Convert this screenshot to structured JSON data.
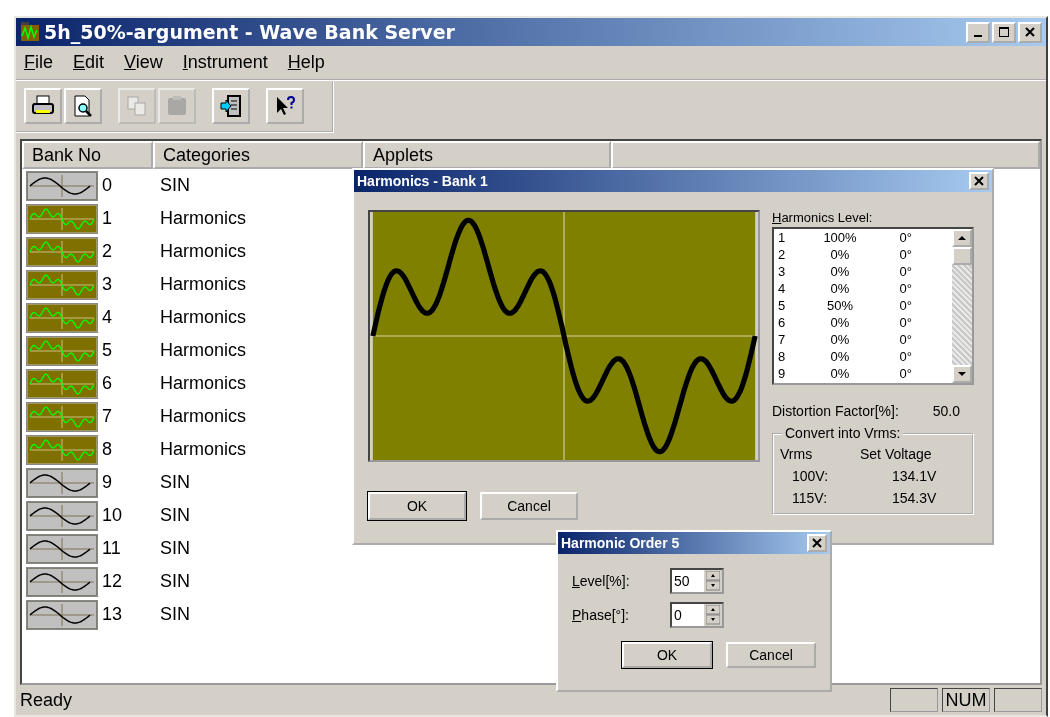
{
  "window": {
    "title": "5h_50%-argument - Wave Bank Server"
  },
  "menu": [
    "File",
    "Edit",
    "View",
    "Instrument",
    "Help"
  ],
  "toolbar": [
    {
      "kind": "print",
      "disabled": false
    },
    {
      "kind": "preview",
      "disabled": false
    },
    {
      "kind": "copy",
      "disabled": true
    },
    {
      "kind": "paste",
      "disabled": true
    },
    {
      "kind": "import",
      "disabled": false
    },
    {
      "kind": "help",
      "disabled": false
    }
  ],
  "columns": [
    "Bank No",
    "Categories",
    "Applets"
  ],
  "rows": [
    {
      "bank": "0",
      "category": "SIN",
      "kind": "sin"
    },
    {
      "bank": "1",
      "category": "Harmonics",
      "kind": "harmonics"
    },
    {
      "bank": "2",
      "category": "Harmonics",
      "kind": "harmonics"
    },
    {
      "bank": "3",
      "category": "Harmonics",
      "kind": "harmonics"
    },
    {
      "bank": "4",
      "category": "Harmonics",
      "kind": "harmonics"
    },
    {
      "bank": "5",
      "category": "Harmonics",
      "kind": "harmonics"
    },
    {
      "bank": "6",
      "category": "Harmonics",
      "kind": "harmonics"
    },
    {
      "bank": "7",
      "category": "Harmonics",
      "kind": "harmonics"
    },
    {
      "bank": "8",
      "category": "Harmonics",
      "kind": "harmonics"
    },
    {
      "bank": "9",
      "category": "SIN",
      "kind": "sin"
    },
    {
      "bank": "10",
      "category": "SIN",
      "kind": "sin"
    },
    {
      "bank": "11",
      "category": "SIN",
      "kind": "sin"
    },
    {
      "bank": "12",
      "category": "SIN",
      "kind": "sin"
    },
    {
      "bank": "13",
      "category": "SIN",
      "kind": "sin"
    }
  ],
  "harmonics_dialog": {
    "title": "Harmonics - Bank 1",
    "list_label": "Harmonics Level:",
    "levels": [
      {
        "order": "1",
        "level": "100%",
        "phase": "0°"
      },
      {
        "order": "2",
        "level": "0%",
        "phase": "0°"
      },
      {
        "order": "3",
        "level": "0%",
        "phase": "0°"
      },
      {
        "order": "4",
        "level": "0%",
        "phase": "0°"
      },
      {
        "order": "5",
        "level": "50%",
        "phase": "0°"
      },
      {
        "order": "6",
        "level": "0%",
        "phase": "0°"
      },
      {
        "order": "7",
        "level": "0%",
        "phase": "0°"
      },
      {
        "order": "8",
        "level": "0%",
        "phase": "0°"
      },
      {
        "order": "9",
        "level": "0%",
        "phase": "0°"
      }
    ],
    "distortion_label": "Distortion Factor[%]:",
    "distortion_value": "50.0",
    "group_label": "Convert into Vrms:",
    "group_headers": [
      "Vrms",
      "Set Voltage"
    ],
    "conversions": [
      {
        "vrms": "100V:",
        "set_voltage": "134.1V"
      },
      {
        "vrms": "115V:",
        "set_voltage": "154.3V"
      }
    ],
    "buttons": [
      "OK",
      "Cancel"
    ]
  },
  "order_dialog": {
    "title": "Harmonic Order 5",
    "fields": [
      {
        "label": "Level[%]:",
        "value": "50"
      },
      {
        "label": "Phase[°]:",
        "value": "0"
      }
    ],
    "buttons": [
      "OK",
      "Cancel"
    ]
  },
  "status_bar": {
    "text": "Ready",
    "panels": [
      {
        "kind": "empty"
      },
      {
        "kind": "text",
        "text": "NUM"
      },
      {
        "kind": "empty"
      }
    ]
  }
}
